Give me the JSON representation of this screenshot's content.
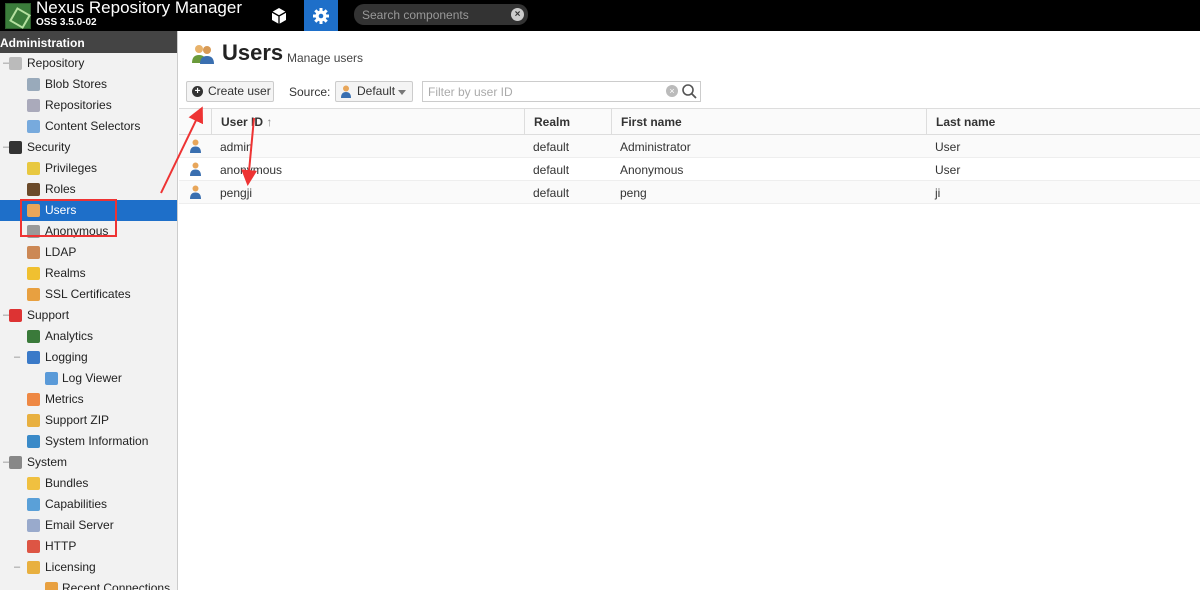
{
  "header": {
    "app_title": "Nexus Repository Manager",
    "app_version": "OSS 3.5.0-02",
    "search_placeholder": "Search components"
  },
  "sidebar": {
    "section_title": "Administration",
    "items": [
      {
        "label": "Repository",
        "level": 1,
        "expand": "–",
        "icon": "database-icon"
      },
      {
        "label": "Blob Stores",
        "level": 2,
        "icon": "blob-store-icon"
      },
      {
        "label": "Repositories",
        "level": 2,
        "icon": "repositories-icon"
      },
      {
        "label": "Content Selectors",
        "level": 2,
        "icon": "content-selector-icon"
      },
      {
        "label": "Security",
        "level": 1,
        "expand": "–",
        "icon": "eye-icon"
      },
      {
        "label": "Privileges",
        "level": 2,
        "icon": "privileges-icon"
      },
      {
        "label": "Roles",
        "level": 2,
        "icon": "roles-icon"
      },
      {
        "label": "Users",
        "level": 2,
        "icon": "users-icon",
        "selected": true
      },
      {
        "label": "Anonymous",
        "level": 2,
        "icon": "anonymous-icon"
      },
      {
        "label": "LDAP",
        "level": 2,
        "icon": "ldap-icon"
      },
      {
        "label": "Realms",
        "level": 2,
        "icon": "realms-icon"
      },
      {
        "label": "SSL Certificates",
        "level": 2,
        "icon": "ssl-certificate-icon"
      },
      {
        "label": "Support",
        "level": 1,
        "expand": "–",
        "icon": "support-icon"
      },
      {
        "label": "Analytics",
        "level": 2,
        "icon": "analytics-icon"
      },
      {
        "label": "Logging",
        "level": 2,
        "expand": "–",
        "icon": "logging-icon"
      },
      {
        "label": "Log Viewer",
        "level": 3,
        "icon": "log-viewer-icon"
      },
      {
        "label": "Metrics",
        "level": 2,
        "icon": "metrics-icon"
      },
      {
        "label": "Support ZIP",
        "level": 2,
        "icon": "support-zip-icon"
      },
      {
        "label": "System Information",
        "level": 2,
        "icon": "globe-icon"
      },
      {
        "label": "System",
        "level": 1,
        "expand": "–",
        "icon": "gear-icon"
      },
      {
        "label": "Bundles",
        "level": 2,
        "icon": "bundles-icon"
      },
      {
        "label": "Capabilities",
        "level": 2,
        "icon": "capabilities-icon"
      },
      {
        "label": "Email Server",
        "level": 2,
        "icon": "email-icon"
      },
      {
        "label": "HTTP",
        "level": 2,
        "icon": "http-icon"
      },
      {
        "label": "Licensing",
        "level": 2,
        "expand": "–",
        "icon": "licensing-icon"
      },
      {
        "label": "Recent Connections",
        "level": 3,
        "icon": "recent-connections-icon"
      }
    ]
  },
  "page": {
    "title": "Users",
    "subtitle": "Manage users"
  },
  "toolbar": {
    "create_label": "Create user",
    "source_label": "Source:",
    "source_value": "Default",
    "filter_placeholder": "Filter by user ID"
  },
  "table": {
    "columns": [
      "User ID",
      "Realm",
      "First name",
      "Last name"
    ],
    "sort_indicator": "↑",
    "rows": [
      {
        "user_id": "admin",
        "realm": "default",
        "first_name": "Administrator",
        "last_name": "User"
      },
      {
        "user_id": "anonymous",
        "realm": "default",
        "first_name": "Anonymous",
        "last_name": "User"
      },
      {
        "user_id": "pengji",
        "realm": "default",
        "first_name": "peng",
        "last_name": "ji"
      }
    ]
  },
  "colors": {
    "accent": "#1e6fc9",
    "annotation": "#e33333"
  }
}
